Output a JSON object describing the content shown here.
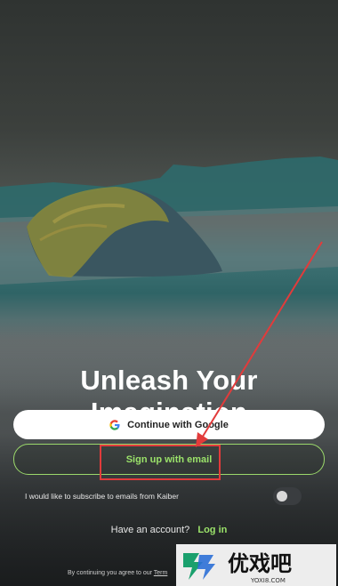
{
  "title": "Unleash Your Imagination",
  "buttons": {
    "google": "Continue with Google",
    "email": "Sign up with email"
  },
  "subscribe": {
    "label": "I would like to subscribe to emails from Kaiber",
    "enabled": false
  },
  "account": {
    "prompt": "Have an account?",
    "login": "Log in"
  },
  "terms": {
    "text": "By continuing you agree to our",
    "link": "Term"
  },
  "watermark": {
    "name": "优戏吧",
    "url": "YOXI8.COM"
  },
  "colors": {
    "accent_green": "#9be36a",
    "annotation_red": "#e23b3b"
  }
}
